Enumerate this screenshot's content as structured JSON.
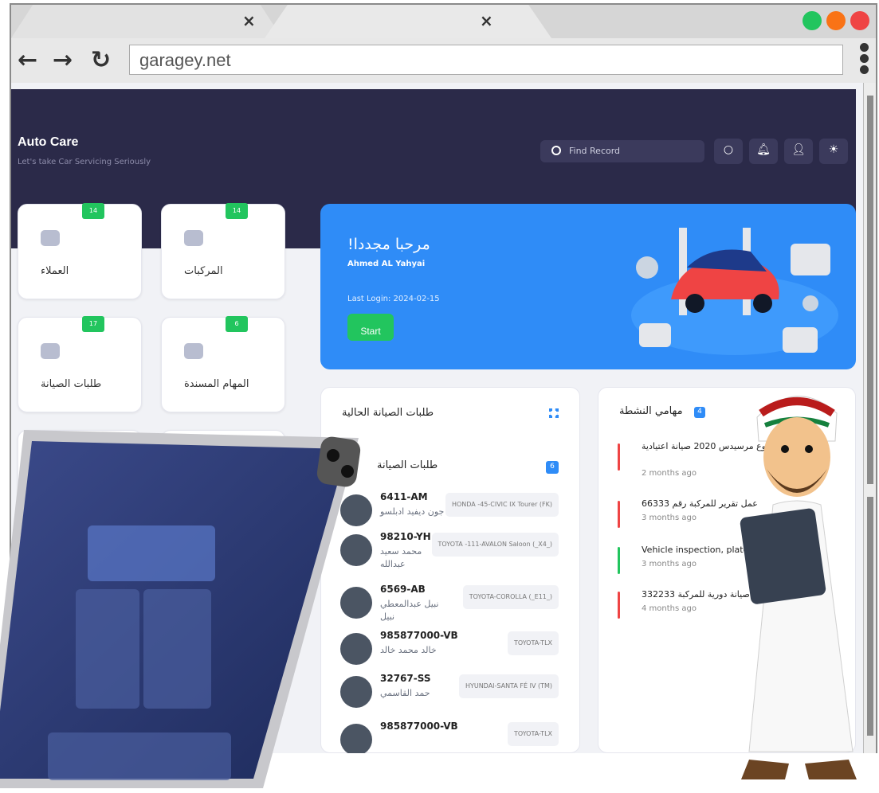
{
  "browser": {
    "tabs": [
      {
        "close": "×"
      },
      {
        "close": "×"
      }
    ],
    "url": "garagey.net",
    "window_dots": [
      "#22c55e",
      "#f97316",
      "#ef4444"
    ]
  },
  "header": {
    "brand": "Auto Care",
    "tagline": "Let's take Car Servicing Seriously",
    "search_placeholder": "Find Record"
  },
  "stats": [
    {
      "label": "العملاء",
      "count": "14",
      "icon": "users-icon"
    },
    {
      "label": "المركبات",
      "count": "14",
      "icon": "car-icon"
    },
    {
      "label": "طلبات الصيانة",
      "count": "17",
      "icon": "wrench-icon"
    },
    {
      "label": "المهام المسندة",
      "count": "6",
      "icon": "check-icon"
    }
  ],
  "welcome": {
    "title": "!مرحبا مجددا",
    "name": "Ahmed AL Yahyai",
    "last_login": "Last Login: 2024-02-15",
    "start": "Start"
  },
  "requests_panel": {
    "title": "طلبات الصيانة الحالية",
    "subtitle": "طلبات الصيانة",
    "count": "6",
    "items": [
      {
        "plate": "6411-AM",
        "owner": "جون ديفيد ادبلسو",
        "model": "HONDA -45-CIVIC IX Tourer (FK)"
      },
      {
        "plate": "98210-YH",
        "owner": "محمد سعيد عبدالله",
        "model": "TOYOTA -111-AVALON Saloon (_X4_)"
      },
      {
        "plate": "6569-AB",
        "owner": "نبيل عبدالمعطي نبيل",
        "model": "TOYOTA-COROLLA (_E11_)"
      },
      {
        "plate": "985877000-VB",
        "owner": "خالد محمد خالد",
        "model": "TOYOTA-TLX"
      },
      {
        "plate": "32767-SS",
        "owner": "حمد القاسمي",
        "model": "HYUNDAI-SANTA FÉ IV (TM)"
      },
      {
        "plate": "985877000-VB",
        "owner": "",
        "model": "TOYOTA-TLX"
      }
    ]
  },
  "tasks_panel": {
    "title": "مهامي النشطة",
    "count": "4",
    "items": [
      {
        "title": "انة مركبة من نوع مرسيدس 2020 صيانة اعتيادية",
        "time": "2 months ago",
        "color": "#ef4444"
      },
      {
        "title": "عمل تقرير للمركبة رقم 66333",
        "time": "3 months ago",
        "color": "#ef4444"
      },
      {
        "title": "Vehicle inspection, plate n",
        "time": "3 months ago",
        "color": "#22c55e"
      },
      {
        "title": "332233 ة صيانة دورية للمركبة",
        "time": "4 months ago",
        "color": "#ef4444"
      }
    ]
  },
  "colors": {
    "header": "#2b2a49",
    "accent": "#2f8cf7",
    "success": "#22c55e"
  }
}
